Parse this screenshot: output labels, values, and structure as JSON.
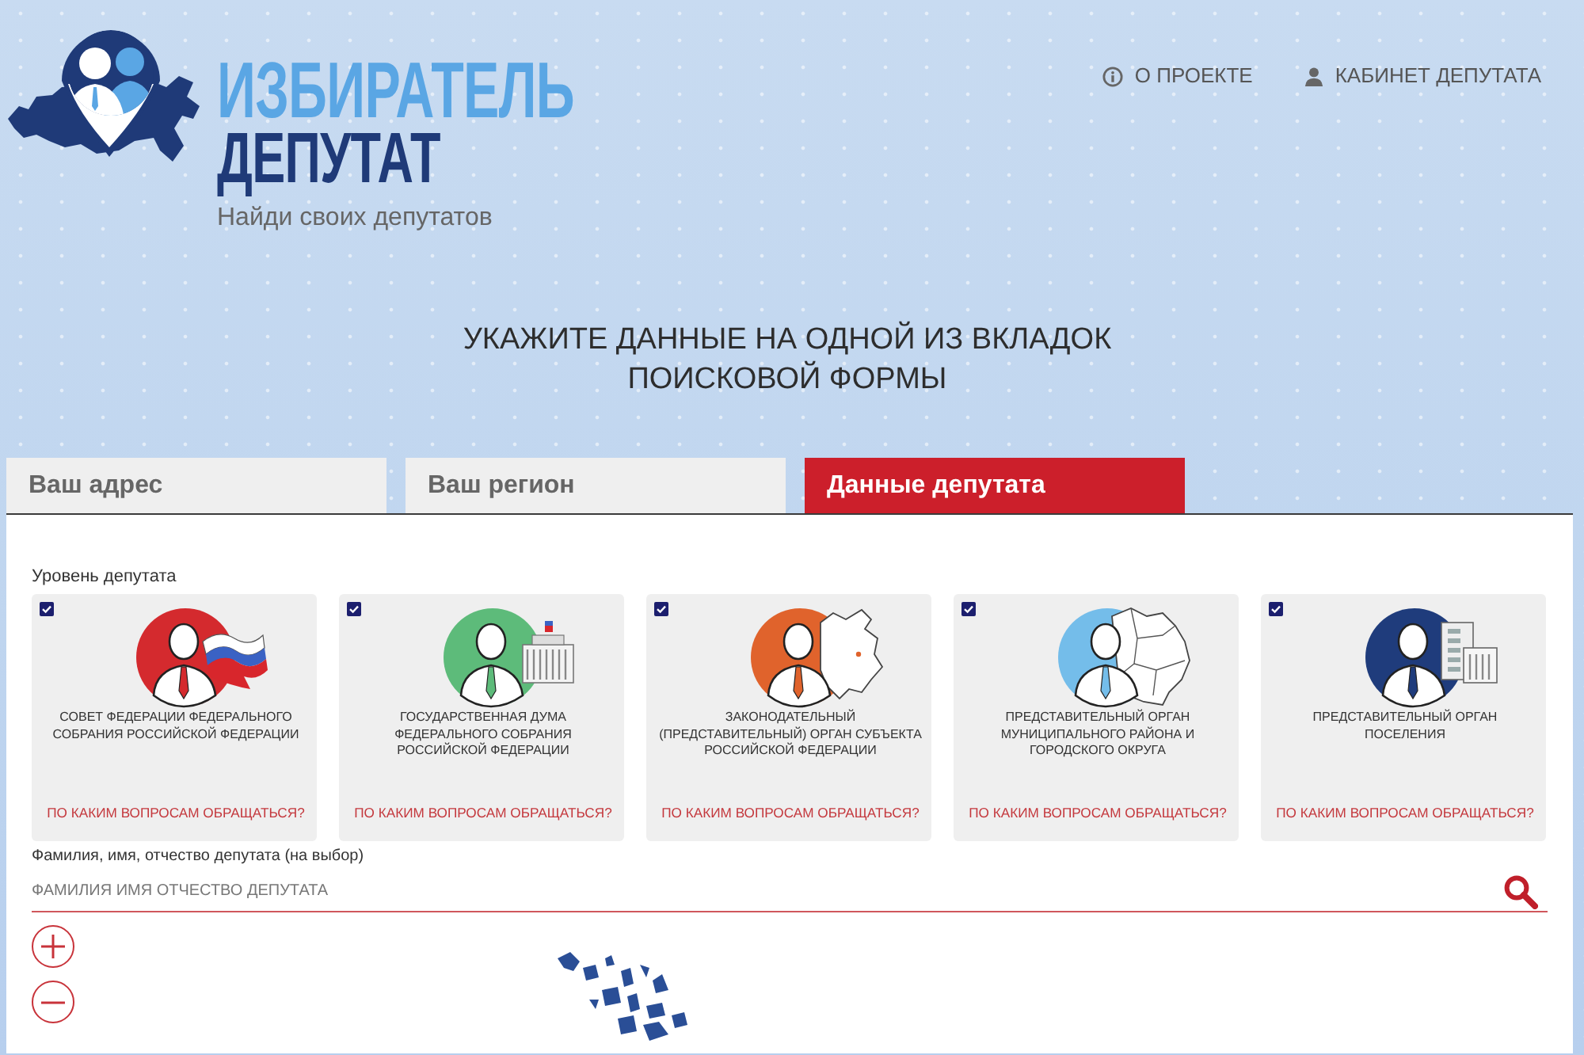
{
  "header": {
    "logo": {
      "line1": "ИЗБИРАТЕЛЬ",
      "line2": "ДЕПУТАТ"
    },
    "tagline": "Найди своих депутатов",
    "nav": [
      {
        "label": "О ПРОЕКТЕ",
        "kind": "info"
      },
      {
        "label": "КАБИНЕТ ДЕПУТАТА",
        "kind": "user"
      }
    ]
  },
  "heading": "УКАЖИТЕ ДАННЫЕ НА ОДНОЙ ИЗ ВКЛАДОК ПОИСКОВОЙ ФОРМЫ",
  "tabs": [
    {
      "label": "Ваш адрес",
      "selected": false
    },
    {
      "label": "Ваш регион",
      "selected": false
    },
    {
      "label": "Данные депутата",
      "selected": true
    }
  ],
  "form": {
    "level_label": "Уровень депутата",
    "levels": [
      {
        "title": "СОВЕТ ФЕДЕРАЦИИ ФЕДЕРАЛЬНОГО СОБРАНИЯ РОССИЙСКОЙ ФЕДЕРАЦИИ",
        "link": "ПО КАКИМ ВОПРОСАМ ОБРАЩАТЬСЯ?",
        "checked": true,
        "color": "#d42a2e",
        "kind": "flag"
      },
      {
        "title": "ГОСУДАРСТВЕННАЯ ДУМА ФЕДЕРАЛЬНОГО СОБРАНИЯ РОССИЙСКОЙ ФЕДЕРАЦИИ",
        "link": "ПО КАКИМ ВОПРОСАМ ОБРАЩАТЬСЯ?",
        "checked": true,
        "color": "#5dbb7a",
        "kind": "building"
      },
      {
        "title": "ЗАКОНОДАТЕЛЬНЫЙ (ПРЕДСТАВИТЕЛЬНЫЙ) ОРГАН СУБЪЕКТА РОССИЙСКОЙ ФЕДЕРАЦИИ",
        "link": "ПО КАКИМ ВОПРОСАМ ОБРАЩАТЬСЯ?",
        "checked": true,
        "color": "#e0632c",
        "kind": "region"
      },
      {
        "title": "ПРЕДСТАВИТЕЛЬНЫЙ ОРГАН МУНИЦИПАЛЬНОГО РАЙОНА И ГОРОДСКОГО ОКРУГА",
        "link": "ПО КАКИМ ВОПРОСАМ ОБРАЩАТЬСЯ?",
        "checked": true,
        "color": "#74bdea",
        "kind": "districts"
      },
      {
        "title": "ПРЕДСТАВИТЕЛЬНЫЙ ОРГАН ПОСЕЛЕНИЯ",
        "link": "ПО КАКИМ ВОПРОСАМ ОБРАЩАТЬСЯ?",
        "checked": true,
        "color": "#1f3c7c",
        "kind": "houses"
      }
    ],
    "name_label": "Фамилия, имя, отчество депутата (на выбор)",
    "name_field": {
      "placeholder": "ФАМИЛИЯ ИМЯ ОТЧЕСТВО ДЕПУТАТА"
    }
  }
}
